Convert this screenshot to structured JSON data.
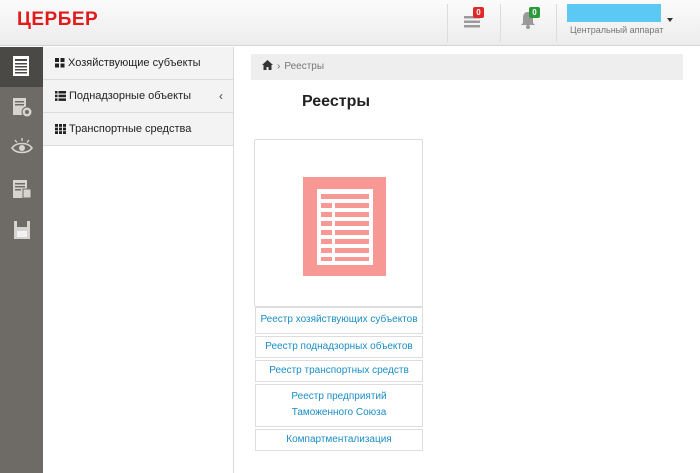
{
  "app": {
    "logo_text": "ЦЕРБЕР"
  },
  "header": {
    "messages_count": "0",
    "notifications_count": "0",
    "user_subtitle": "Центральный аппарат",
    "colors": {
      "user_box": "#5cc9f5",
      "messages_badge": "#e02a2a",
      "notifications_badge": "#2a9a3a"
    }
  },
  "rail": {
    "items": [
      {
        "icon": "registry-book-icon",
        "active": true
      },
      {
        "icon": "document-settings-icon",
        "active": false
      },
      {
        "icon": "eye-icon",
        "active": false
      },
      {
        "icon": "document-list-icon",
        "active": false
      },
      {
        "icon": "save-disk-icon",
        "active": false
      }
    ]
  },
  "subnav": {
    "items": [
      {
        "label": "Хозяйствующие субъекты",
        "icon": "grid-icon"
      },
      {
        "label": "Поднадзорные объекты",
        "icon": "list-icon",
        "has_chevron": true,
        "chevron": "‹"
      },
      {
        "label": "Транспортные средства",
        "icon": "grid-3x3-icon"
      }
    ]
  },
  "breadcrumb": {
    "home_icon": "home-icon",
    "separator": "›",
    "current": "Реестры"
  },
  "page": {
    "title": "Реестры"
  },
  "card": {
    "image_icon": "registry-table-icon",
    "accent_color": "#f79894",
    "links": [
      "Реестр хозяйствующих субъектов",
      "Реестр поднадзорных объектов",
      "Реестр транспортных средств",
      "Реестр предприятий Таможенного Союза",
      "Компартментализация"
    ]
  }
}
